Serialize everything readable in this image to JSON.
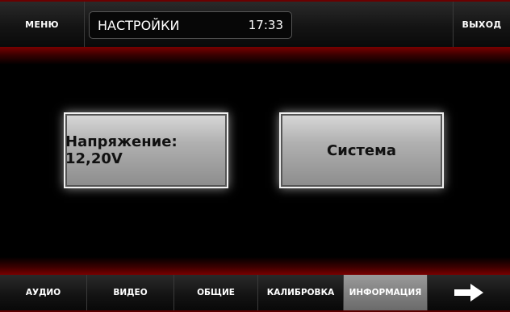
{
  "header": {
    "menu_label": "МЕНЮ",
    "title": "НАСТРОЙКИ",
    "time": "17:33",
    "exit_label": "ВЫХОД"
  },
  "main": {
    "voltage_button": "Напряжение: 12,20V",
    "system_button": "Система"
  },
  "tabs": [
    {
      "label": "АУДИО",
      "active": false
    },
    {
      "label": "ВИДЕО",
      "active": false
    },
    {
      "label": "ОБЩИЕ",
      "active": false
    },
    {
      "label": "КАЛИБРОВКА",
      "active": false
    },
    {
      "label": "ИНФОРМАЦИЯ",
      "active": true
    }
  ],
  "next_icon": "arrow-right-icon",
  "colors": {
    "accent_red": "#7a0000",
    "button_silver": "#b0b0b0"
  }
}
